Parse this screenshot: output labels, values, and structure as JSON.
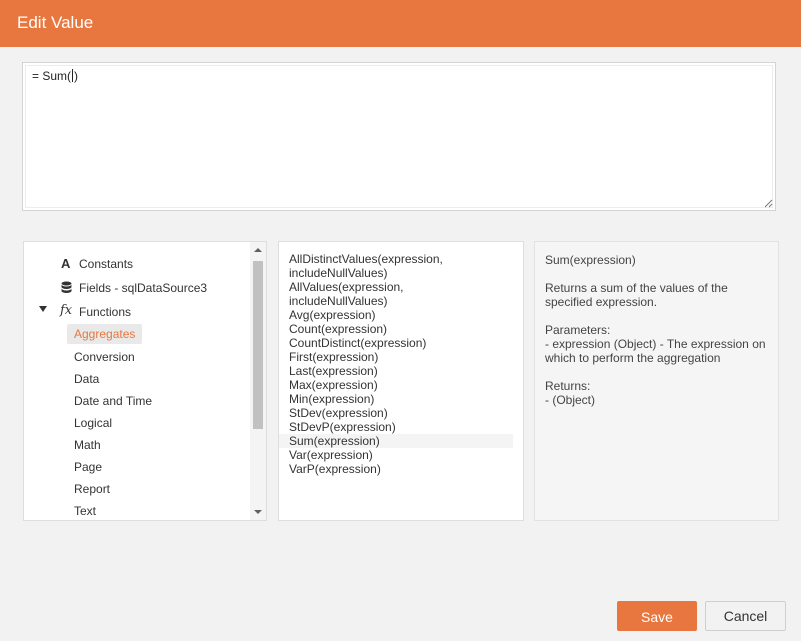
{
  "dialog": {
    "title": "Edit Value"
  },
  "expression": {
    "before_caret": "= Sum(",
    "after_caret": ")"
  },
  "tree": {
    "constants_label": "Constants",
    "fields_label": "Fields - sqlDataSource3",
    "functions_label": "Functions",
    "categories": [
      "Aggregates",
      "Conversion",
      "Data",
      "Date and Time",
      "Logical",
      "Math",
      "Page",
      "Report",
      "Text"
    ],
    "selected_category": "Aggregates"
  },
  "functions": [
    "AllDistinctValues(expression,",
    "includeNullValues)",
    "AllValues(expression, includeNullValues)",
    "Avg(expression)",
    "Count(expression)",
    "CountDistinct(expression)",
    "First(expression)",
    "Last(expression)",
    "Max(expression)",
    "Min(expression)",
    "StDev(expression)",
    "StDevP(expression)",
    "Sum(expression)",
    "Var(expression)",
    "VarP(expression)"
  ],
  "hovered_function": "Sum(expression)",
  "description": {
    "signature": "Sum(expression)",
    "summary": "Returns a sum of the values of the specified expression.",
    "parameters_heading": "Parameters:",
    "parameters_text": "- expression (Object) - The expression on which to perform the aggregation",
    "returns_heading": "Returns:",
    "returns_text": "- (Object)"
  },
  "buttons": {
    "save": "Save",
    "cancel": "Cancel"
  },
  "colors": {
    "accent": "#e8773f"
  }
}
